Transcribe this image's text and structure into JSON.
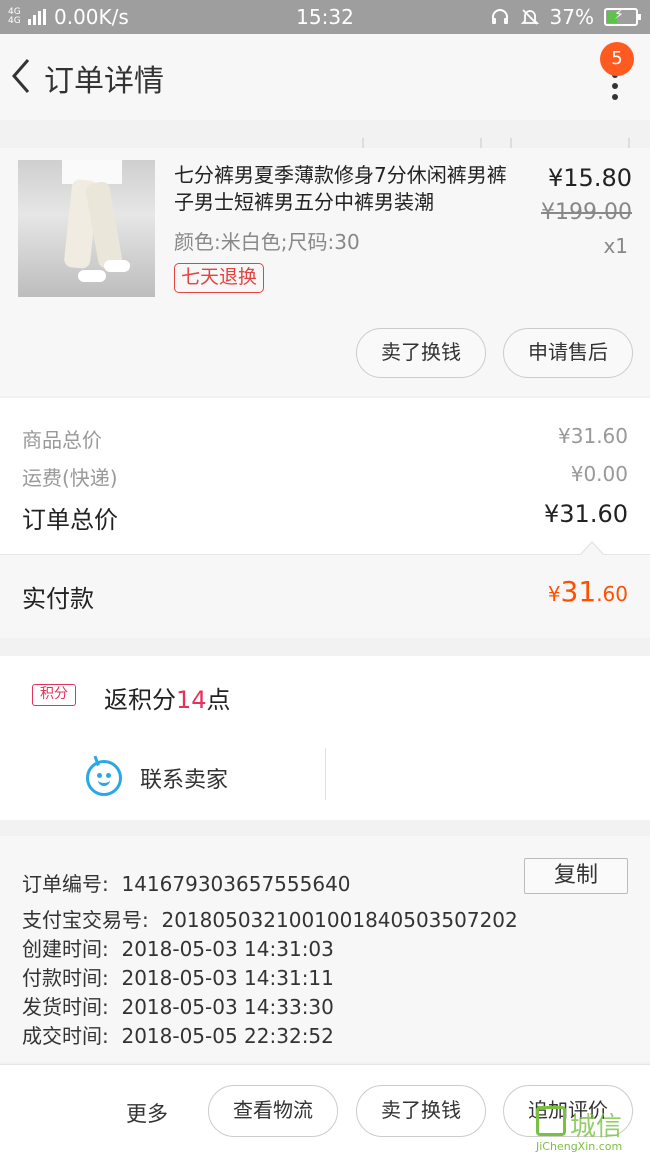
{
  "status_bar": {
    "network": "4G 4G",
    "speed": "0.00K/s",
    "time": "15:32",
    "battery": "37%",
    "battery_level": 0.37
  },
  "header": {
    "title": "订单详情",
    "badge_count": "5"
  },
  "product": {
    "title": "七分裤男夏季薄款修身7分休闲裤男裤子男士短裤男五分中裤男装潮",
    "price": "¥15.80",
    "original_price": "¥199.00",
    "quantity": "x1",
    "sku": "颜色:米白色;尺码:30",
    "tag": "七天退换",
    "buttons": [
      "卖了换钱",
      "申请售后"
    ]
  },
  "summary": {
    "goods_total_label": "商品总价",
    "goods_total": "¥31.60",
    "shipping_label": "运费(快递)",
    "shipping": "¥0.00",
    "order_total_label": "订单总价",
    "order_total": "¥31.60",
    "paid_label": "实付款",
    "paid_currency": "¥",
    "paid_int": "31",
    "paid_dec": ".60"
  },
  "points": {
    "badge": "积分",
    "prefix": "返积分",
    "count": "14",
    "suffix": "点",
    "contact_label": "联系卖家"
  },
  "order_info": {
    "rows": [
      {
        "label": "订单编号:",
        "value": "141679303657555640"
      },
      {
        "label": "支付宝交易号:",
        "value": "2018050321001001840503507202"
      },
      {
        "label": "创建时间:",
        "value": "2018-05-03 14:31:03"
      },
      {
        "label": "付款时间:",
        "value": "2018-05-03 14:31:11"
      },
      {
        "label": "发货时间:",
        "value": "2018-05-03 14:33:30"
      },
      {
        "label": "成交时间:",
        "value": "2018-05-05 22:32:52"
      }
    ],
    "copy_label": "复制"
  },
  "bottom_bar": {
    "more": "更多",
    "buttons": [
      "查看物流",
      "卖了换钱",
      "追加评价"
    ]
  },
  "watermark": {
    "text": "城信",
    "sub": "JiChengXin.com"
  },
  "colors": {
    "accent_orange": "#ff5000",
    "tag_red": "#e64340",
    "points_pink": "#e6315b",
    "contact_blue": "#29a8e6"
  }
}
